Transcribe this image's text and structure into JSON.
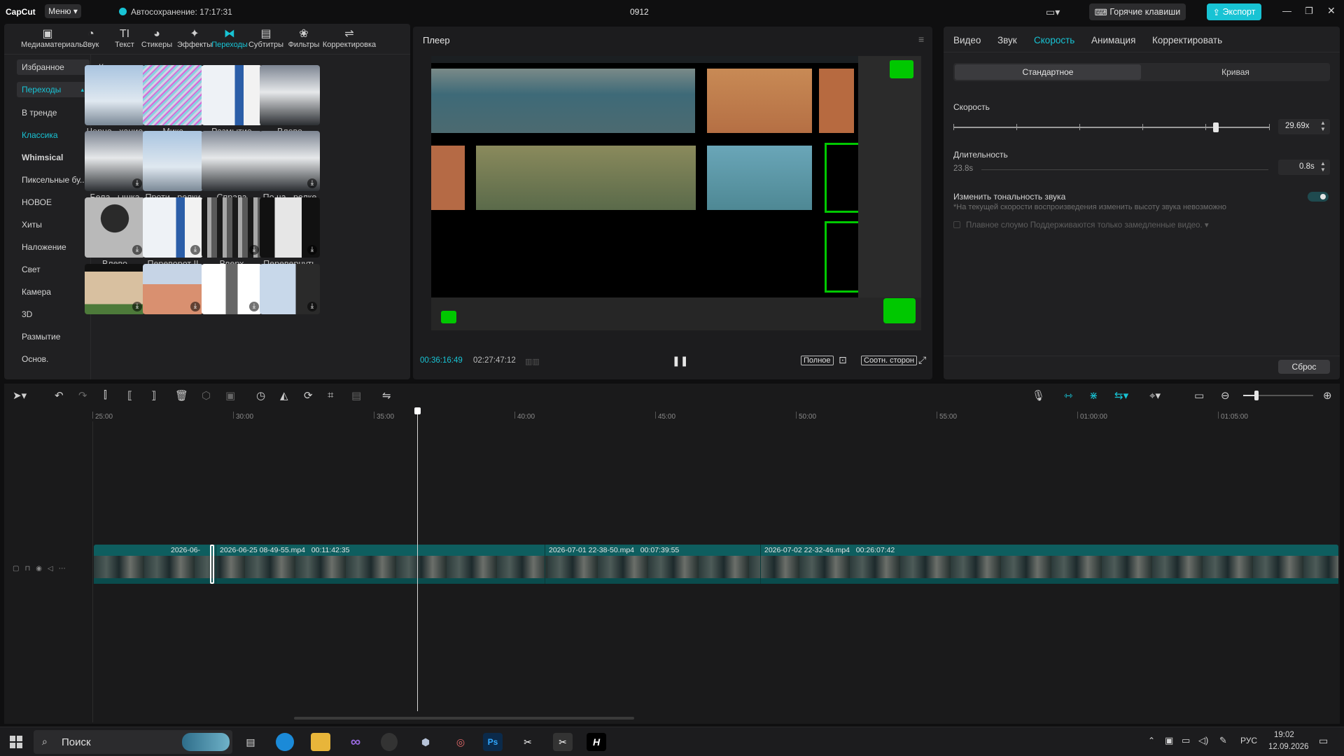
{
  "app": {
    "logo": "CapCut",
    "menu": "Меню",
    "autosave": "Автосохранение: 17:17:31",
    "project": "0912",
    "hotkeys": "Горячие клавиши",
    "export": "Экспорт"
  },
  "toolbar": [
    {
      "label": "Медиаматериалы",
      "icon": "media-icon"
    },
    {
      "label": "Звук",
      "icon": "sound-icon"
    },
    {
      "label": "Текст",
      "icon": "text-icon"
    },
    {
      "label": "Стикеры",
      "icon": "sticker-icon"
    },
    {
      "label": "Эффекты",
      "icon": "effects-icon"
    },
    {
      "label": "Переходы",
      "icon": "transitions-icon",
      "active": true
    },
    {
      "label": "Субтитры",
      "icon": "subtitles-icon"
    },
    {
      "label": "Фильтры",
      "icon": "filters-icon"
    },
    {
      "label": "Корректировка",
      "icon": "adjust-icon"
    }
  ],
  "categories": [
    "Избранное",
    "Переходы",
    "В тренде",
    "Классика",
    "Whimsical",
    "Пиксельные бу...",
    "НОВОЕ",
    "Хиты",
    "Наложение",
    "Свет",
    "Камера",
    "3D",
    "Размытие",
    "Основ."
  ],
  "section_title": "Классика",
  "thumbs": [
    "Черно...хание",
    "Микс",
    "Размытие",
    "Влево",
    "Бела...ышка",
    "Проти...релки",
    "Справа",
    "По ча...релке",
    "Влево",
    "Переворот II",
    "Вверх",
    "Перевернуть",
    "",
    "",
    "",
    ""
  ],
  "player": {
    "title": "Плеер",
    "current": "00:36:16:49",
    "total": "02:27:47:12",
    "full": "Полное",
    "ratio": "Соотн. сторон"
  },
  "props": {
    "tabs": [
      "Видео",
      "Звук",
      "Скорость",
      "Анимация",
      "Корректировать"
    ],
    "active_tab": "Скорость",
    "speed_modes": [
      "Стандартное",
      "Кривая"
    ],
    "speed_label": "Скорость",
    "speed_value": "29.69x",
    "speed_level": 0.83,
    "duration_label": "Длительность",
    "duration_left": "23.8s",
    "duration_value": "0.8s",
    "pitch_label": "Изменить тональность звука",
    "pitch_note": "*На текущей скорости воспроизведения изменить высоту звука невозможно",
    "smooth": "Плавное слоумо Поддерживаются только замедленные видео.",
    "reset": "Сброс"
  },
  "ruler": [
    "25:00",
    "30:00",
    "35:00",
    "40:00",
    "45:00",
    "50:00",
    "55:00",
    "01:00:00",
    "01:05:00"
  ],
  "clips": [
    {
      "name": "2026-06-",
      "dur": ""
    },
    {
      "name": "2026-06-25 08-49-55.mp4",
      "dur": "00:11:42:35"
    },
    {
      "name": "2026-07-01 22-38-50.mp4",
      "dur": "00:07:39:55"
    },
    {
      "name": "2026-07-02 22-32-46.mp4",
      "dur": "00:26:07:42"
    }
  ],
  "taskbar": {
    "search": "Поиск",
    "lang": "РУС",
    "time": "19:02",
    "date": "12.09.2026"
  },
  "colors": {
    "accent": "#18c3d4",
    "green": "#00c800",
    "clip": "#0e6e6e"
  }
}
